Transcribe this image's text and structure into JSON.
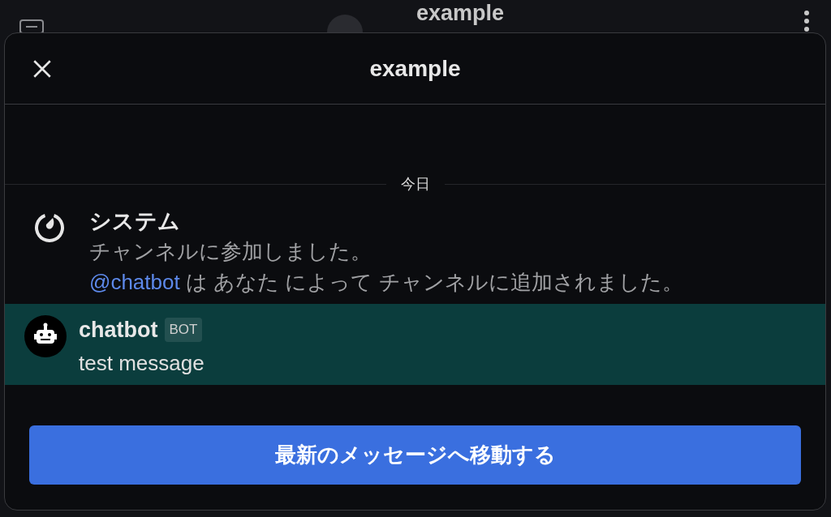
{
  "background_header": {
    "title": "example"
  },
  "modal": {
    "title": "example",
    "date_separator": "今日",
    "posts": [
      {
        "kind": "system",
        "author": "システム",
        "highlighted": false,
        "lines": [
          {
            "text": "チャンネルに参加しました。"
          },
          {
            "mention": "@chatbot",
            "text": " は あなた によって チャンネルに追加されました。"
          }
        ]
      },
      {
        "kind": "bot",
        "author": "chatbot",
        "badge": "BOT",
        "highlighted": true,
        "lines": [
          {
            "text": "test message"
          }
        ]
      }
    ],
    "jump_button": "最新のメッセージへ移動する"
  }
}
